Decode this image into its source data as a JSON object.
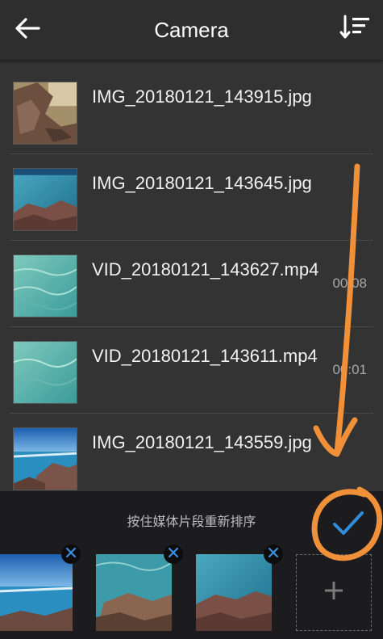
{
  "header": {
    "title": "Camera",
    "back_icon": "arrow-left-icon",
    "sort_icon": "sort-icon"
  },
  "files": [
    {
      "name": "IMG_20180121_143915.jpg",
      "duration": ""
    },
    {
      "name": "IMG_20180121_143645.jpg",
      "duration": ""
    },
    {
      "name": "VID_20180121_143627.mp4",
      "duration": "00:08"
    },
    {
      "name": "VID_20180121_143611.mp4",
      "duration": "00:01"
    },
    {
      "name": "IMG_20180121_143559.jpg",
      "duration": ""
    }
  ],
  "bottom": {
    "hint": "按住媒体片段重新排序",
    "confirm_icon": "checkmark-icon",
    "remove_icon": "close-icon",
    "add_icon": "plus-icon"
  },
  "colors": {
    "background": "#333333",
    "header": "#2e2e2e",
    "panel": "#1c1c1f",
    "accent_blue": "#2f8ddc",
    "annotation_orange": "#f0913a"
  }
}
